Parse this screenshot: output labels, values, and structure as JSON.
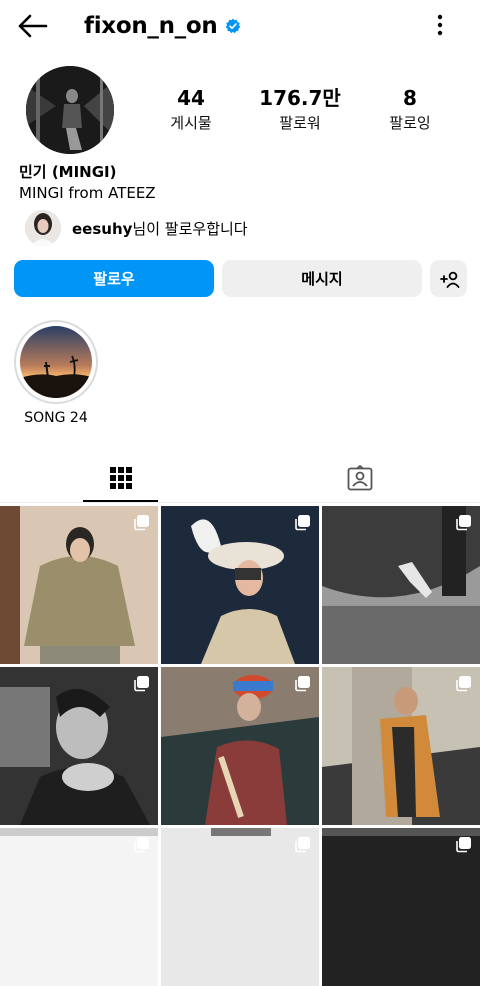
{
  "header": {
    "title": "fixon_n_on",
    "back_icon": "back-arrow-icon",
    "verified_icon": "verified-badge-icon",
    "more_icon": "more-vertical-icon"
  },
  "stats": [
    {
      "value": "44",
      "label": "게시물"
    },
    {
      "value": "176.7만",
      "label": "팔로워"
    },
    {
      "value": "8",
      "label": "팔로잉"
    }
  ],
  "profile": {
    "name": "민기 (MINGI)",
    "bio": "MINGI from ATEEZ"
  },
  "followed_by": {
    "user": "eesuhy",
    "suffix": "님이 팔로우합니다"
  },
  "actions": {
    "follow": "팔로우",
    "message": "메시지",
    "add_user_icon": "add-person-icon"
  },
  "highlights": [
    {
      "label": "SONG 24"
    }
  ],
  "tabs": [
    {
      "icon": "grid-icon",
      "active": true
    },
    {
      "icon": "tagged-person-icon",
      "active": false
    }
  ],
  "colors": {
    "accent": "#0095f6",
    "secondary_bg": "#efefef",
    "verified": "#0095f6"
  },
  "posts": [
    {
      "name": "post-1",
      "multi": true
    },
    {
      "name": "post-2",
      "multi": true
    },
    {
      "name": "post-3",
      "multi": true
    },
    {
      "name": "post-4",
      "multi": true
    },
    {
      "name": "post-5",
      "multi": true
    },
    {
      "name": "post-6",
      "multi": true
    },
    {
      "name": "post-7",
      "multi": true
    },
    {
      "name": "post-8",
      "multi": true
    },
    {
      "name": "post-9",
      "multi": true
    }
  ]
}
